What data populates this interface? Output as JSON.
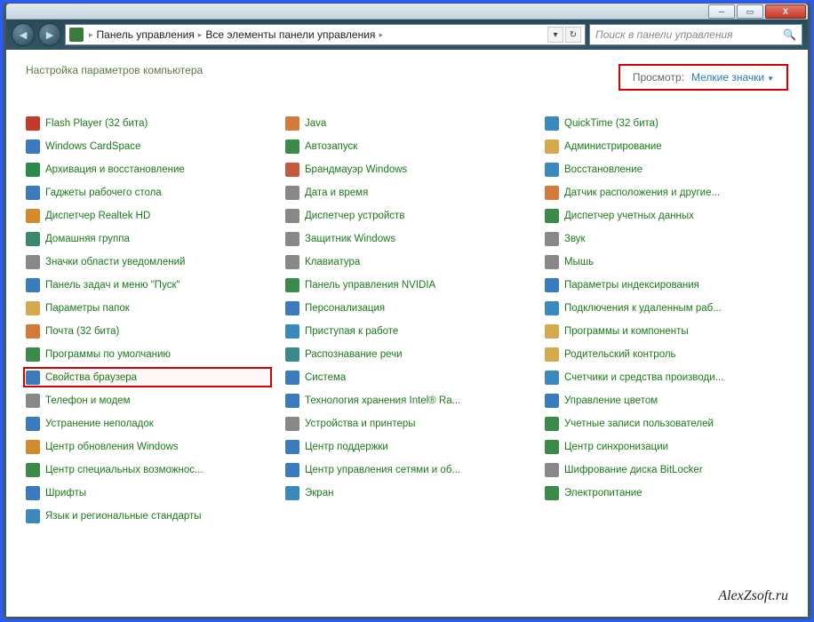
{
  "breadcrumb": {
    "level1": "Панель управления",
    "level2": "Все элементы панели управления"
  },
  "search": {
    "placeholder": "Поиск в панели управления"
  },
  "heading": "Настройка параметров компьютера",
  "view": {
    "label": "Просмотр:",
    "value": "Мелкие значки"
  },
  "watermark": "AlexZsoft.ru",
  "columns": [
    [
      {
        "label": "Flash Player (32 бита)",
        "icon": "flash",
        "c": "#c43a28"
      },
      {
        "label": "Windows CardSpace",
        "icon": "cardspace",
        "c": "#3a7abf"
      },
      {
        "label": "Архивация и восстановление",
        "icon": "backup",
        "c": "#2a8a4a"
      },
      {
        "label": "Гаджеты рабочего стола",
        "icon": "gadgets",
        "c": "#3a7abf"
      },
      {
        "label": "Диспетчер Realtek HD",
        "icon": "realtek",
        "c": "#d48a2a"
      },
      {
        "label": "Домашняя группа",
        "icon": "homegroup",
        "c": "#3a8a6a"
      },
      {
        "label": "Значки области уведомлений",
        "icon": "tray",
        "c": "#888"
      },
      {
        "label": "Панель задач и меню \"Пуск\"",
        "icon": "taskbar",
        "c": "#3a7abf"
      },
      {
        "label": "Параметры папок",
        "icon": "folderopts",
        "c": "#d4aa4a"
      },
      {
        "label": "Почта (32 бита)",
        "icon": "mail",
        "c": "#d47a3a"
      },
      {
        "label": "Программы по умолчанию",
        "icon": "defaults",
        "c": "#3a8a4a"
      },
      {
        "label": "Свойства браузера",
        "icon": "inetopts",
        "c": "#3a7abf",
        "highlight": true
      },
      {
        "label": "Телефон и модем",
        "icon": "phone",
        "c": "#888"
      },
      {
        "label": "Устранение неполадок",
        "icon": "trouble",
        "c": "#3a7abf"
      },
      {
        "label": "Центр обновления Windows",
        "icon": "update",
        "c": "#d48a2a"
      },
      {
        "label": "Центр специальных возможнос...",
        "icon": "ease",
        "c": "#3a8a4a"
      },
      {
        "label": "Шрифты",
        "icon": "fonts",
        "c": "#3a7abf"
      },
      {
        "label": "Язык и региональные стандарты",
        "icon": "region",
        "c": "#3a8abf"
      }
    ],
    [
      {
        "label": "Java",
        "icon": "java",
        "c": "#d47a3a"
      },
      {
        "label": "Автозапуск",
        "icon": "autoplay",
        "c": "#3a8a4a"
      },
      {
        "label": "Брандмауэр Windows",
        "icon": "firewall",
        "c": "#c45a3a"
      },
      {
        "label": "Дата и время",
        "icon": "datetime",
        "c": "#888"
      },
      {
        "label": "Диспетчер устройств",
        "icon": "devmgr",
        "c": "#888"
      },
      {
        "label": "Защитник Windows",
        "icon": "defender",
        "c": "#888"
      },
      {
        "label": "Клавиатура",
        "icon": "keyboard",
        "c": "#888"
      },
      {
        "label": "Панель управления NVIDIA",
        "icon": "nvidia",
        "c": "#3a8a4a"
      },
      {
        "label": "Персонализация",
        "icon": "personalize",
        "c": "#3a7abf"
      },
      {
        "label": "Приступая к работе",
        "icon": "getstarted",
        "c": "#3a8abf"
      },
      {
        "label": "Распознавание речи",
        "icon": "speech",
        "c": "#3a8a8a"
      },
      {
        "label": "Система",
        "icon": "system",
        "c": "#3a7abf"
      },
      {
        "label": "Технология хранения Intel® Ra...",
        "icon": "intel",
        "c": "#3a7abf"
      },
      {
        "label": "Устройства и принтеры",
        "icon": "devices",
        "c": "#888"
      },
      {
        "label": "Центр поддержки",
        "icon": "action",
        "c": "#3a7abf"
      },
      {
        "label": "Центр управления сетями и об...",
        "icon": "network",
        "c": "#3a7abf"
      },
      {
        "label": "Экран",
        "icon": "display",
        "c": "#3a8abf"
      }
    ],
    [
      {
        "label": "QuickTime (32 бита)",
        "icon": "quicktime",
        "c": "#3a8abf"
      },
      {
        "label": "Администрирование",
        "icon": "admin",
        "c": "#d4aa4a"
      },
      {
        "label": "Восстановление",
        "icon": "recovery",
        "c": "#3a8abf"
      },
      {
        "label": "Датчик расположения и другие...",
        "icon": "sensors",
        "c": "#d47a3a"
      },
      {
        "label": "Диспетчер учетных данных",
        "icon": "creds",
        "c": "#3a8a4a"
      },
      {
        "label": "Звук",
        "icon": "sound",
        "c": "#888"
      },
      {
        "label": "Мышь",
        "icon": "mouse",
        "c": "#888"
      },
      {
        "label": "Параметры индексирования",
        "icon": "index",
        "c": "#3a7abf"
      },
      {
        "label": "Подключения к удаленным раб...",
        "icon": "remote",
        "c": "#3a8abf"
      },
      {
        "label": "Программы и компоненты",
        "icon": "programs",
        "c": "#d4aa4a"
      },
      {
        "label": "Родительский контроль",
        "icon": "parental",
        "c": "#d4aa4a"
      },
      {
        "label": "Счетчики и средства производи...",
        "icon": "perf",
        "c": "#3a8abf"
      },
      {
        "label": "Управление цветом",
        "icon": "color",
        "c": "#3a7abf"
      },
      {
        "label": "Учетные записи пользователей",
        "icon": "users",
        "c": "#3a8a4a"
      },
      {
        "label": "Центр синхронизации",
        "icon": "sync",
        "c": "#3a8a4a"
      },
      {
        "label": "Шифрование диска BitLocker",
        "icon": "bitlocker",
        "c": "#888"
      },
      {
        "label": "Электропитание",
        "icon": "power",
        "c": "#3a8a4a"
      }
    ]
  ]
}
